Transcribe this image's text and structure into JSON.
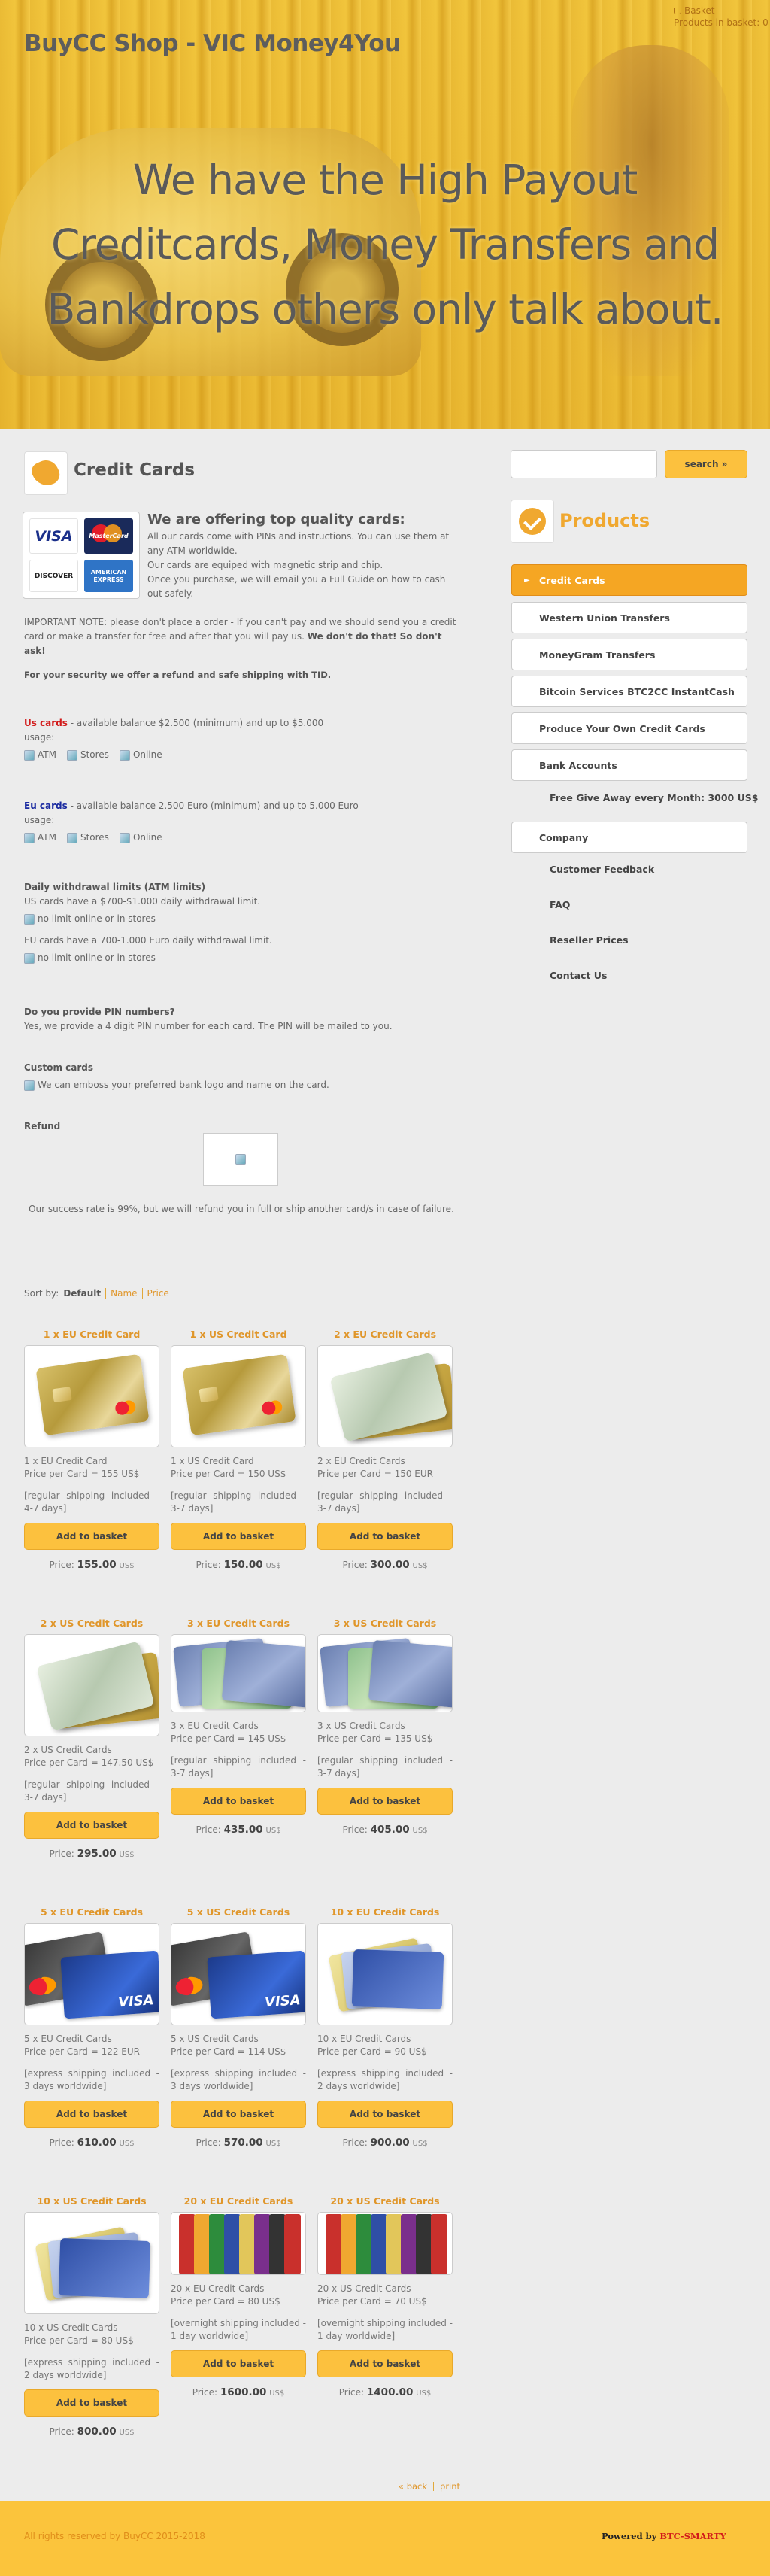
{
  "header": {
    "site_title": "BuyCC Shop - VIC Money4You",
    "basket_label": "Basket",
    "basket_count_label": "Products in basket:",
    "basket_count": "0",
    "headline": "We have the High Payout Creditcards, Money Transfers and Bankdrops others only talk about."
  },
  "page": {
    "title": "Credit Cards",
    "offer_title": "We are offering top quality cards:",
    "offer_lines": [
      "All our cards come with PINs and instructions. You can use them at any ATM worldwide.",
      "Our cards are equiped with magnetic strip and chip.",
      "Once you purchase, we will email you a Full Guide on how to cash out safely."
    ],
    "important_note": "IMPORTANT NOTE: please don't place a order  - If you can't pay and we should send you a credit card or make a transfer for free and after that you will pay us.",
    "important_note_bold": "We don't do that! So don't ask!",
    "security": "For your security we offer a refund and safe shipping with TID.",
    "us_label": "Us cards",
    "us_text": " - available balance $2.500 (minimum) and up to $5.000",
    "eu_label": "Eu cards",
    "eu_text": " - available balance 2.500 Euro (minimum) and up to 5.000 Euro",
    "usage": "usage:",
    "atm": "ATM",
    "stores": "Stores",
    "online": "Online",
    "limits_title": "Daily withdrawal limits (ATM limits)",
    "limits_us": "US cards have a $700-$1.000 daily withdrawal limit.",
    "limits_eu": "EU cards have a 700-1.000 Euro daily withdrawal limit.",
    "no_limit": "no limit online or in stores",
    "pin_q": "Do you provide PIN numbers?",
    "pin_a": "Yes, we provide a 4 digit PIN number for each card. The PIN will be mailed to you.",
    "custom_title": "Custom cards",
    "custom_text": "We can emboss your preferred bank logo and name on the card.",
    "refund_title": "Refund",
    "refund_text": "Our success rate is 99%, but we will refund you in full or ship another card/s in case of failure."
  },
  "logos": {
    "visa": "VISA",
    "mastercard": "MasterCard",
    "discover": "DISCOVER",
    "amex": "AMERICAN EXPRESS"
  },
  "sort": {
    "label": "Sort by:",
    "default": "Default",
    "name": "Name",
    "price": "Price"
  },
  "button_label": "Add to basket",
  "price_prefix": "Price:",
  "currency": "US$",
  "products": [
    {
      "title": "1 x EU Credit Card",
      "name": "1 x EU Credit Card",
      "ppc": "Price per Card = 155 US$",
      "ship": "[regular shipping included - 4-7 days]",
      "price": "155.00",
      "img": "gold"
    },
    {
      "title": "1 x US Credit Card",
      "name": "1 x US Credit Card",
      "ppc": "Price per Card = 150 US$",
      "ship": "[regular shipping included - 3-7 days]",
      "price": "150.00",
      "img": "gold"
    },
    {
      "title": "2 x EU Credit Cards",
      "name": "2 x EU Credit Cards",
      "ppc": "Price per Card = 150 EUR",
      "ship": "[regular shipping included - 3-7 days]",
      "price": "300.00",
      "img": "silver"
    },
    {
      "title": "2 x US Credit Cards",
      "name": "2 x US Credit Cards",
      "ppc": "Price per Card = 147.50 US$",
      "ship": "[regular shipping included - 3-7 days]",
      "price": "295.00",
      "img": "silver"
    },
    {
      "title": "3 x EU Credit Cards",
      "name": "3 x EU Credit Cards",
      "ppc": "Price per Card = 145 US$",
      "ship": "[regular shipping included - 3-7 days]",
      "price": "435.00",
      "img": "amex"
    },
    {
      "title": "3 x US Credit Cards",
      "name": "3 x US Credit Cards",
      "ppc": "Price per Card = 135 US$",
      "ship": "[regular shipping included - 3-7 days]",
      "price": "405.00",
      "img": "amex"
    },
    {
      "title": "5 x EU Credit Cards",
      "name": "5 x EU Credit Cards",
      "ppc": "Price per Card = 122 EUR",
      "ship": "[express shipping included - 3 days worldwide]",
      "price": "610.00",
      "img": "visa"
    },
    {
      "title": "5 x US Credit Cards",
      "name": "5 x US Credit Cards",
      "ppc": "Price per Card = 114 US$",
      "ship": "[express shipping included - 3 days worldwide]",
      "price": "570.00",
      "img": "visa"
    },
    {
      "title": "10 x EU Credit Cards",
      "name": "10 x EU Credit Cards",
      "ppc": "Price per Card = 90 US$",
      "ship": "[express shipping included - 2 days worldwide]",
      "price": "900.00",
      "img": "fan"
    },
    {
      "title": "10 x US Credit Cards",
      "name": "10 x US Credit Cards",
      "ppc": "Price per Card = 80 US$",
      "ship": "[express shipping included - 2 days worldwide]",
      "price": "800.00",
      "img": "fan"
    },
    {
      "title": "20 x EU Credit Cards",
      "name": "20 x EU Credit Cards",
      "ppc": "Price per Card = 80 US$",
      "ship": "[overnight shipping included - 1 day worldwide]",
      "price": "1600.00",
      "img": "stack"
    },
    {
      "title": "20 x US Credit Cards",
      "name": "20 x US Credit Cards",
      "ppc": "Price per Card = 70 US$",
      "ship": "[overnight shipping included - 1 day worldwide]",
      "price": "1400.00",
      "img": "stack"
    }
  ],
  "bottom": {
    "back": "« back",
    "print": "print"
  },
  "footer": {
    "copyright": "All rights reserved by BuyCC 2015-2018",
    "powered_prefix": "Powered by ",
    "powered_brand": "BTC-SMARTY"
  },
  "sidebar": {
    "search_placeholder": "",
    "search_button": "search »",
    "products_title": "Products",
    "nav": [
      {
        "label": "Credit Cards",
        "active": true
      },
      {
        "label": "Western Union Transfers"
      },
      {
        "label": "MoneyGram Transfers"
      },
      {
        "label": "Bitcoin Services BTC2CC InstantCash"
      },
      {
        "label": "Produce Your Own Credit Cards"
      },
      {
        "label": "Bank Accounts"
      }
    ],
    "free_giveaway": "Free Give Away every Month: 3000 US$",
    "company": "Company",
    "sub": [
      "Customer Feedback",
      "FAQ",
      "Reseller Prices",
      "Contact Us"
    ]
  },
  "colors": {
    "accent": "#f5a623",
    "button": "#fcc13e",
    "link": "#e0962a"
  }
}
